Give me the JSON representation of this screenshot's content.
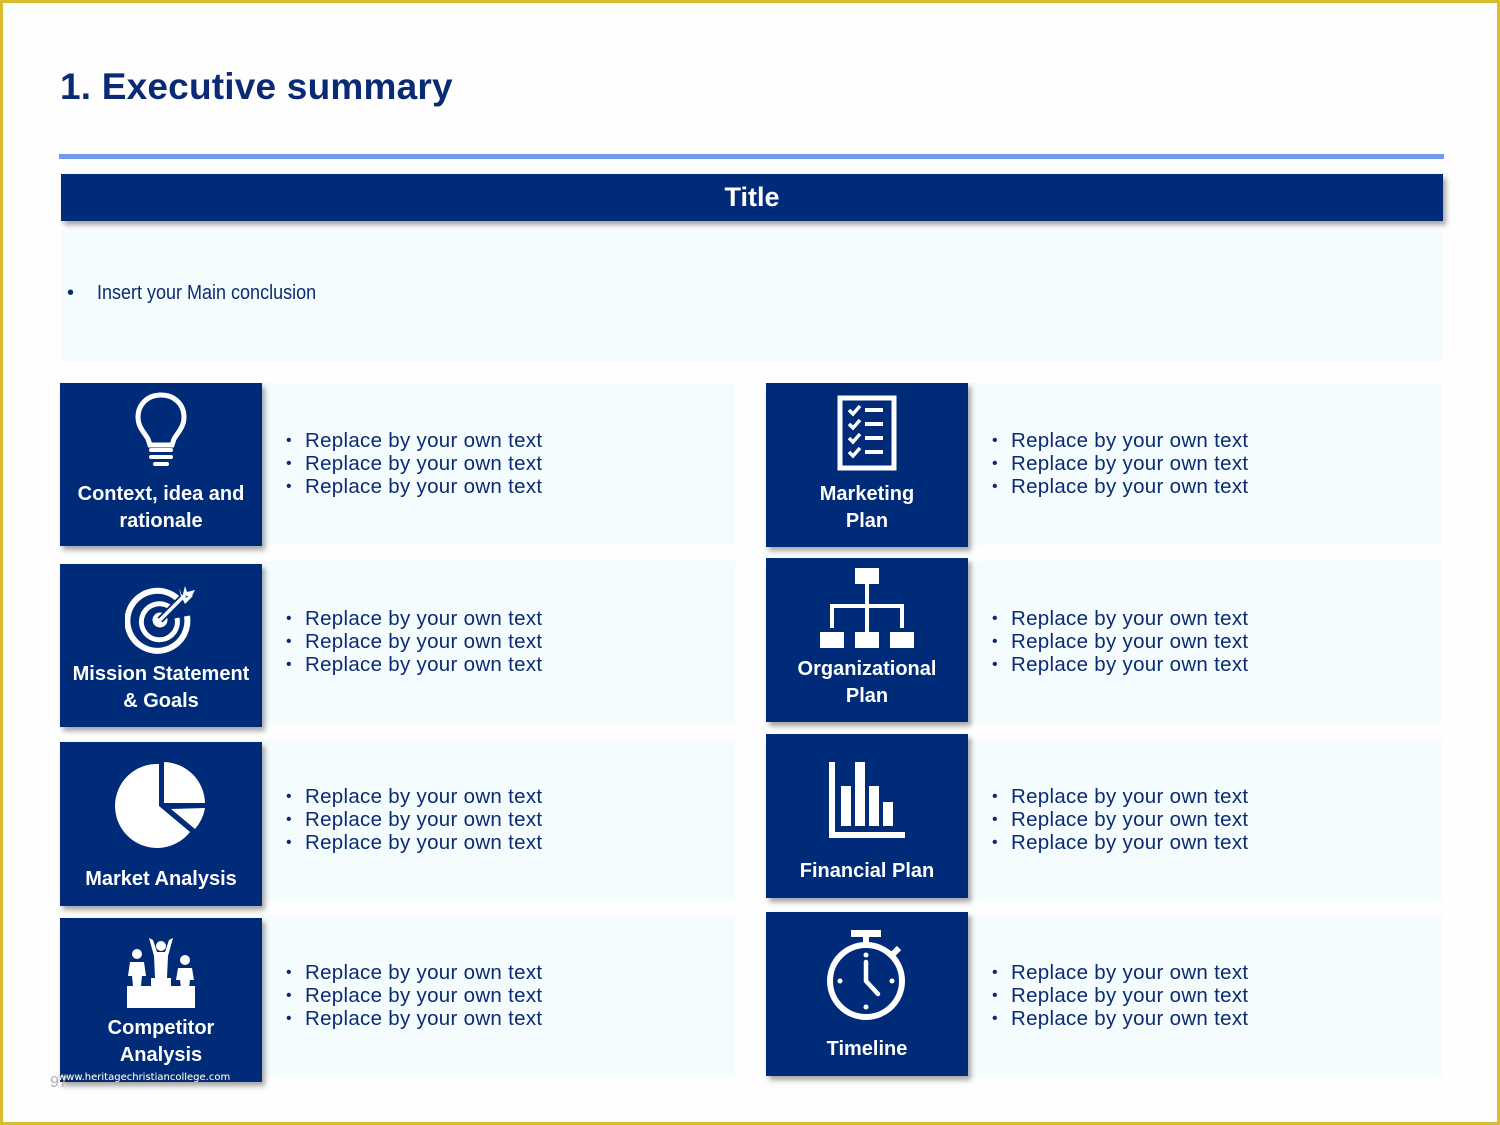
{
  "page": {
    "title": "1. Executive summary",
    "page_number": "97",
    "watermark": "www.heritagechristiancollege.com"
  },
  "colors": {
    "navy": "#002b78",
    "title_text": "#0b2a75",
    "rule": "#6e9bf0",
    "panel_bg": "#f4fcfd",
    "frame": "#d9bd2e"
  },
  "title_bar": {
    "label": "Title"
  },
  "conclusion": {
    "bullet": "•",
    "text": "Insert your Main conclusion"
  },
  "sections": [
    {
      "id": "context",
      "icon": "lightbulb-icon",
      "label": "Context, idea and\nrationale",
      "bullets": [
        "Replace by your own text",
        "Replace by your own text",
        "Replace by your own text"
      ]
    },
    {
      "id": "marketing",
      "icon": "checklist-icon",
      "label": "Marketing\nPlan",
      "bullets": [
        "Replace by your own text",
        "Replace by your own text",
        "Replace by your own text"
      ]
    },
    {
      "id": "mission",
      "icon": "target-icon",
      "label": "Mission  Statement\n& Goals",
      "bullets": [
        "Replace by your own text",
        "Replace by your own text",
        "Replace by your own text"
      ]
    },
    {
      "id": "organizational",
      "icon": "org-chart-icon",
      "label": "Organizational\nPlan",
      "bullets": [
        "Replace by your own text",
        "Replace by your own text",
        "Replace by your own text"
      ]
    },
    {
      "id": "market",
      "icon": "pie-chart-icon",
      "label": "Market  Analysis",
      "bullets": [
        "Replace by your own text",
        "Replace by your own text",
        "Replace by your own text"
      ]
    },
    {
      "id": "financial",
      "icon": "bar-chart-icon",
      "label": "Financial  Plan",
      "bullets": [
        "Replace by your own text",
        "Replace by your own text",
        "Replace by your own text"
      ]
    },
    {
      "id": "competitor",
      "icon": "podium-icon",
      "label": "Competitor\nAnalysis",
      "bullets": [
        "Replace by your own text",
        "Replace by your own text",
        "Replace by your own text"
      ]
    },
    {
      "id": "timeline",
      "icon": "stopwatch-icon",
      "label": "Timeline",
      "bullets": [
        "Replace by your own text",
        "Replace by your own text",
        "Replace by your own text"
      ]
    }
  ],
  "bullet_char": "•"
}
